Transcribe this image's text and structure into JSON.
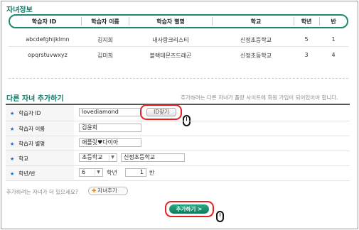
{
  "children_section": {
    "title": "자녀정보",
    "columns": [
      "학습자 ID",
      "학습자 이름",
      "학습자 별명",
      "학교",
      "학년",
      "반"
    ],
    "rows": [
      [
        "abcdefghijklmn",
        "김지희",
        "내사랑크리스티",
        "신정초등학교",
        "5",
        "1"
      ],
      [
        "opqrstuvwxyz",
        "김미희",
        "블랙데몬즈드래곤",
        "신정초등학교",
        "3",
        "4"
      ]
    ]
  },
  "add_section": {
    "title": "다른 자녀 추가하기",
    "note": "추가하려는 다른 자녀가 플랑 사이트에 회원 가입이 되어있어야 합니다.",
    "fields": {
      "id_label": "학습자 ID",
      "id_value": "lovediamond",
      "id_check_button": "ID찾기",
      "name_label": "학습자 이름",
      "name_value": "김윤희",
      "nick_label": "학습자 별명",
      "nick_value": "애플릿♥다이아",
      "school_label": "학교",
      "school_type": "초등학교",
      "school_name": "신정초등학교",
      "grade_label": "학년/반",
      "grade_value": "6",
      "grade_unit": "학년",
      "class_value": "1",
      "class_unit": "반"
    },
    "more_prompt": "추가하려는 자녀가 더 있으세요?",
    "add_child_button": "자녀추가",
    "submit_button": "추가하기 >"
  }
}
